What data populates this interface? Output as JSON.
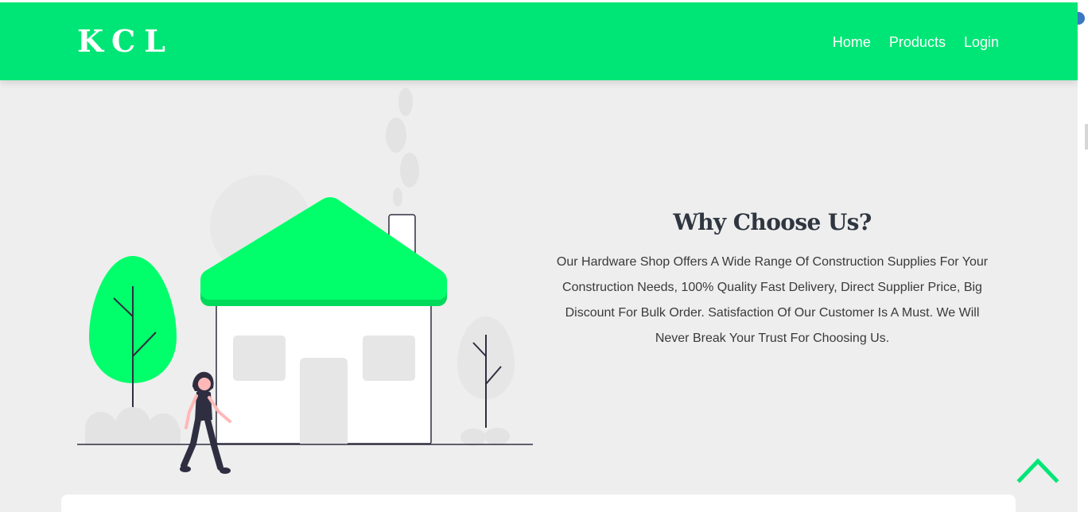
{
  "navbar": {
    "brand": "KCL",
    "links": [
      "Home",
      "Products",
      "Login"
    ]
  },
  "why": {
    "title": "Why Choose Us?",
    "description": "Our Hardware Shop Offers A Wide Range Of Construction Supplies For Your Construction Needs, 100% Quality Fast Delivery, Direct Supplier Price, Big Discount For Bulk Order. Satisfaction Of Our Customer Is A Must. We Will Never Break Your Trust For Choosing Us."
  },
  "icons": {
    "scroll_top": "chevron-up-icon"
  },
  "colors": {
    "primary": "#00e676",
    "roof": "#00ff6a",
    "text_dark": "#2f3640"
  }
}
